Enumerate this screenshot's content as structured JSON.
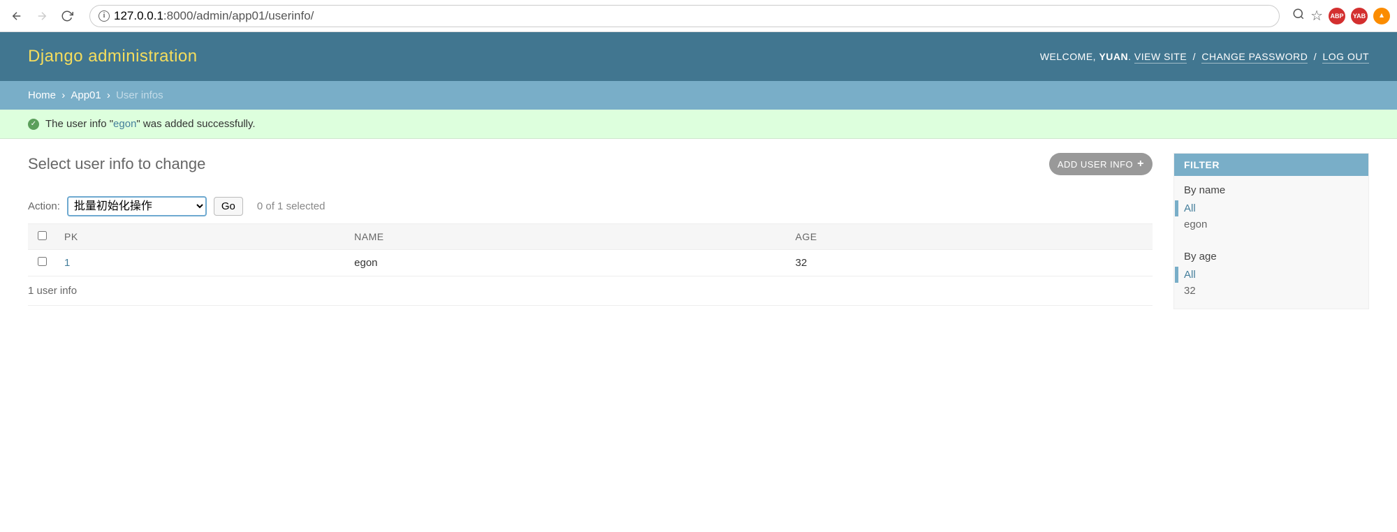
{
  "browser": {
    "url_host": "127.0.0.1",
    "url_path": ":8000/admin/app01/userinfo/",
    "ext1": "ABP",
    "ext2": "YAB"
  },
  "header": {
    "branding": "Django administration",
    "welcome": "WELCOME,",
    "username": "YUAN",
    "view_site": "VIEW SITE",
    "change_password": "CHANGE PASSWORD",
    "log_out": "LOG OUT"
  },
  "breadcrumbs": {
    "home": "Home",
    "app": "App01",
    "current": "User infos"
  },
  "message": {
    "prefix": "The user info \"",
    "link": "egon",
    "suffix": "\" was added successfully."
  },
  "page": {
    "title": "Select user info to change",
    "add_label": "ADD USER INFO"
  },
  "actions": {
    "label": "Action:",
    "selected_option": "批量初始化操作",
    "go": "Go",
    "counter": "0 of 1 selected"
  },
  "table": {
    "headers": {
      "pk": "PK",
      "name": "NAME",
      "age": "AGE"
    },
    "rows": [
      {
        "pk": "1",
        "name": "egon",
        "age": "32"
      }
    ],
    "summary": "1 user info"
  },
  "filter": {
    "title": "FILTER",
    "sections": [
      {
        "heading": "By name",
        "items": [
          "All",
          "egon"
        ],
        "selected": 0
      },
      {
        "heading": "By age",
        "items": [
          "All",
          "32"
        ],
        "selected": 0
      }
    ]
  }
}
